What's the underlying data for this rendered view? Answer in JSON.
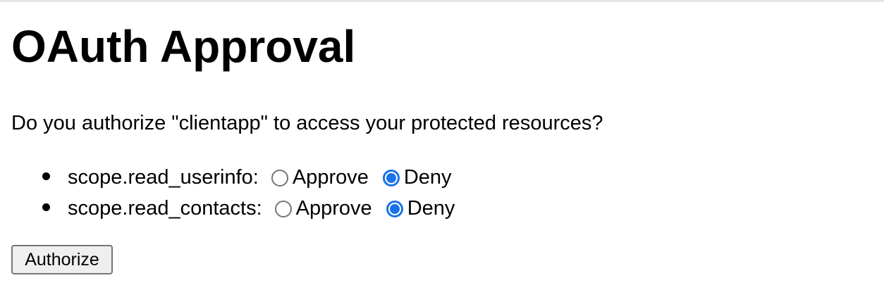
{
  "page": {
    "title": "OAuth Approval",
    "question": "Do you authorize \"clientapp\" to access your protected resources?"
  },
  "scopes": [
    {
      "label": "scope.read_userinfo:",
      "options": [
        {
          "label": "Approve",
          "checked": false
        },
        {
          "label": "Deny",
          "checked": true
        }
      ]
    },
    {
      "label": "scope.read_contacts:",
      "options": [
        {
          "label": "Approve",
          "checked": false
        },
        {
          "label": "Deny",
          "checked": true
        }
      ]
    }
  ],
  "form": {
    "submit_label": "Authorize"
  },
  "colors": {
    "radio_checked": "#1a73e8",
    "button_background": "#efefef"
  }
}
